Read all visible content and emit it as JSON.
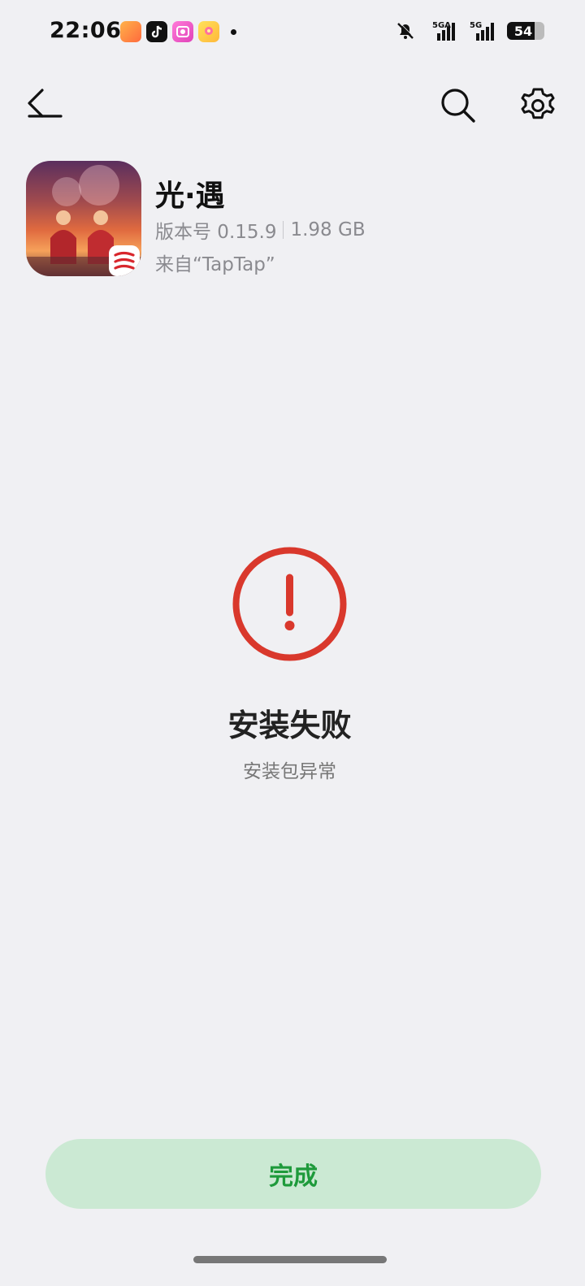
{
  "status_bar": {
    "time": "22:06",
    "notification_apps": [
      "video-app-icon",
      "tiktok-icon",
      "camera-app-icon",
      "flower-app-icon"
    ],
    "signal_1_label": "5GA",
    "signal_2_label": "5G",
    "battery_level": "54"
  },
  "toolbar": {
    "back_icon": "back-arrow-icon",
    "search_icon": "search-icon",
    "settings_icon": "gear-icon"
  },
  "app": {
    "name": "光·遇",
    "version": "版本号 0.15.9",
    "size": "1.98 GB",
    "source": "来自“TapTap”"
  },
  "result": {
    "title": "安装失败",
    "message": "安装包异常",
    "accent_color": "#d9382c"
  },
  "footer": {
    "done_label": "完成",
    "done_bg": "#cbe9d3",
    "done_text_color": "#1e9a3b"
  }
}
